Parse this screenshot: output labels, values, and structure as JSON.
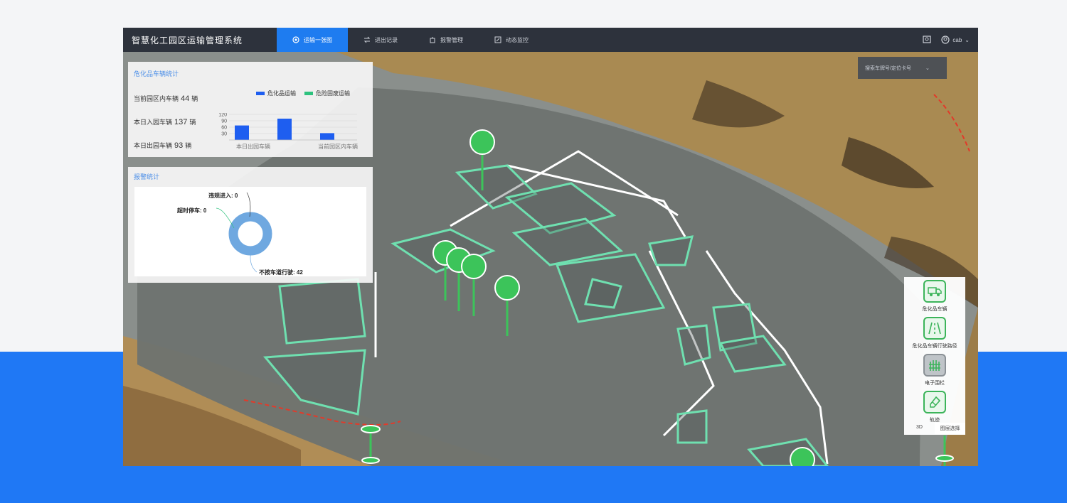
{
  "app": {
    "title": "智慧化工园区运输管理系统"
  },
  "nav": [
    {
      "label": "运输一张图",
      "icon": "map-icon",
      "active": true
    },
    {
      "label": "进出记录",
      "icon": "exchange-icon",
      "active": false
    },
    {
      "label": "报警管理",
      "icon": "alarm-icon",
      "active": false
    },
    {
      "label": "动态监控",
      "icon": "monitor-icon",
      "active": false
    }
  ],
  "header": {
    "user_name": "cab",
    "icons": [
      "screen-icon",
      "user-icon",
      "chevron-down-icon"
    ]
  },
  "search": {
    "placeholder": "搜索车牌号/定位卡号"
  },
  "vehicle_panel": {
    "title": "危化品车辆统计",
    "stats": [
      {
        "label": "当前园区内车辆",
        "value": "44",
        "unit": "辆"
      },
      {
        "label": "本日入园车辆",
        "value": "137",
        "unit": "辆"
      },
      {
        "label": "本日出园车辆",
        "value": "93",
        "unit": "辆"
      }
    ]
  },
  "chart_data": [
    {
      "type": "bar",
      "categories": [
        "本日出园车辆",
        "",
        "当前园区内车辆"
      ],
      "series": [
        {
          "name": "危化品运输",
          "color": "#1e5ef0",
          "values": [
            68,
            100,
            32
          ]
        },
        {
          "name": "危险固废运输",
          "color": "#2ec27e",
          "values": [
            null,
            null,
            null
          ]
        }
      ],
      "yticks": [
        "120",
        "90",
        "60",
        "30"
      ],
      "ylim": [
        0,
        120
      ],
      "legend": "top"
    },
    {
      "type": "pie",
      "title": "报警统计",
      "labels": [
        "违规进入",
        "超时停车",
        "不按车道行驶"
      ],
      "values": [
        0,
        0,
        42
      ],
      "display": [
        "违规进入: 0",
        "超时停车: 0",
        "不按车道行驶: 42"
      ],
      "color": "#6fa8e0"
    }
  ],
  "tools": [
    {
      "label": "危化品车辆",
      "icon": "truck-icon",
      "active": false
    },
    {
      "label": "危化品车辆行驶路径",
      "icon": "road-icon",
      "active": false
    },
    {
      "label": "电子围栏",
      "icon": "fence-icon",
      "active": true
    },
    {
      "label": "轨迹",
      "icon": "eraser-icon",
      "active": false
    }
  ],
  "modes": [
    "3D",
    "图层选择"
  ],
  "colors": {
    "accent": "#1e7cf0",
    "header_bg": "#2d323c",
    "zone_line": "#6fe0b0",
    "marker": "#3cc45a"
  }
}
